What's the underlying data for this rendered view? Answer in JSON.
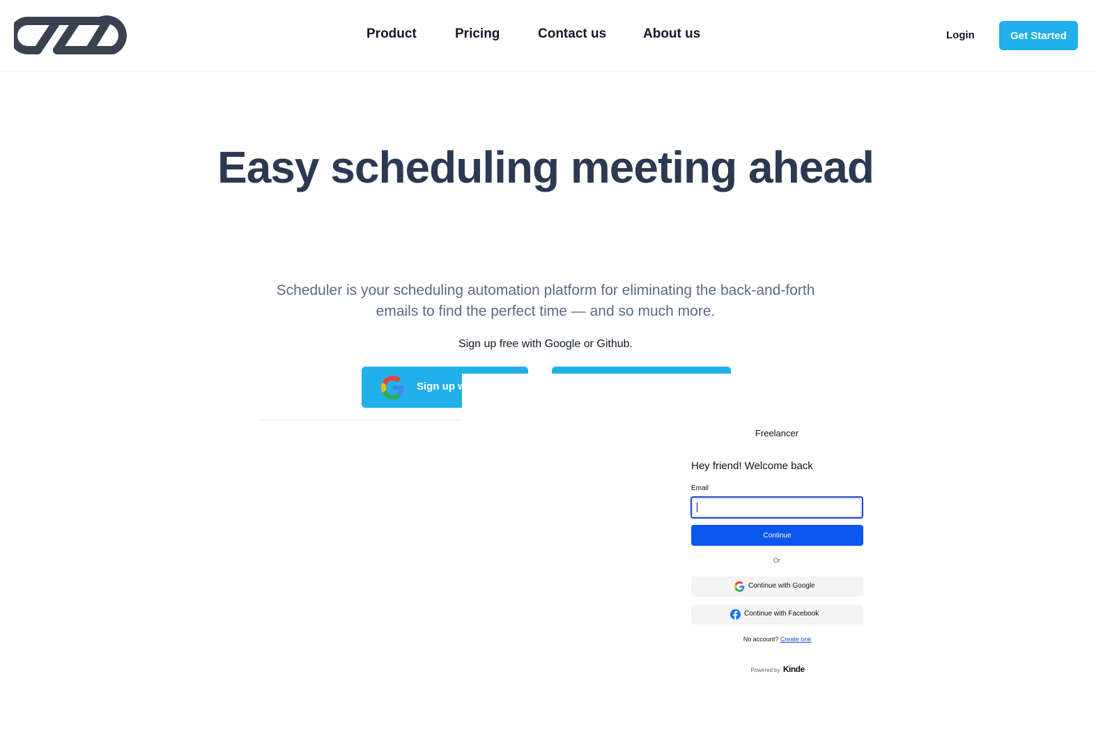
{
  "header": {
    "nav": [
      "Product",
      "Pricing",
      "Contact us",
      "About us"
    ],
    "login_label": "Login",
    "get_started_label": "Get Started",
    "accent_color": "#20b0ea"
  },
  "hero": {
    "title": "Easy scheduling meeting ahead",
    "subtitle": "Scheduler is your scheduling automation platform for eliminating the back-and-forth emails to find the perfect time — and so much more.",
    "signup_note": "Sign up free with Google or Github.",
    "google_button_label": "Sign up with Google",
    "google_icon": "google-icon"
  },
  "auth": {
    "brand": "Freelancer",
    "welcome": "Hey friend! Welcome back",
    "email_label": "Email",
    "email_value": "",
    "continue_label": "Continue",
    "or_label": "Or",
    "google_label": "Continue with Google",
    "facebook_label": "Continue with Facebook",
    "no_account_text": "No account?",
    "create_label": "Create one",
    "powered_by": "Powered by",
    "powered_brand": "Kinde",
    "primary_color": "#0a57f0"
  }
}
